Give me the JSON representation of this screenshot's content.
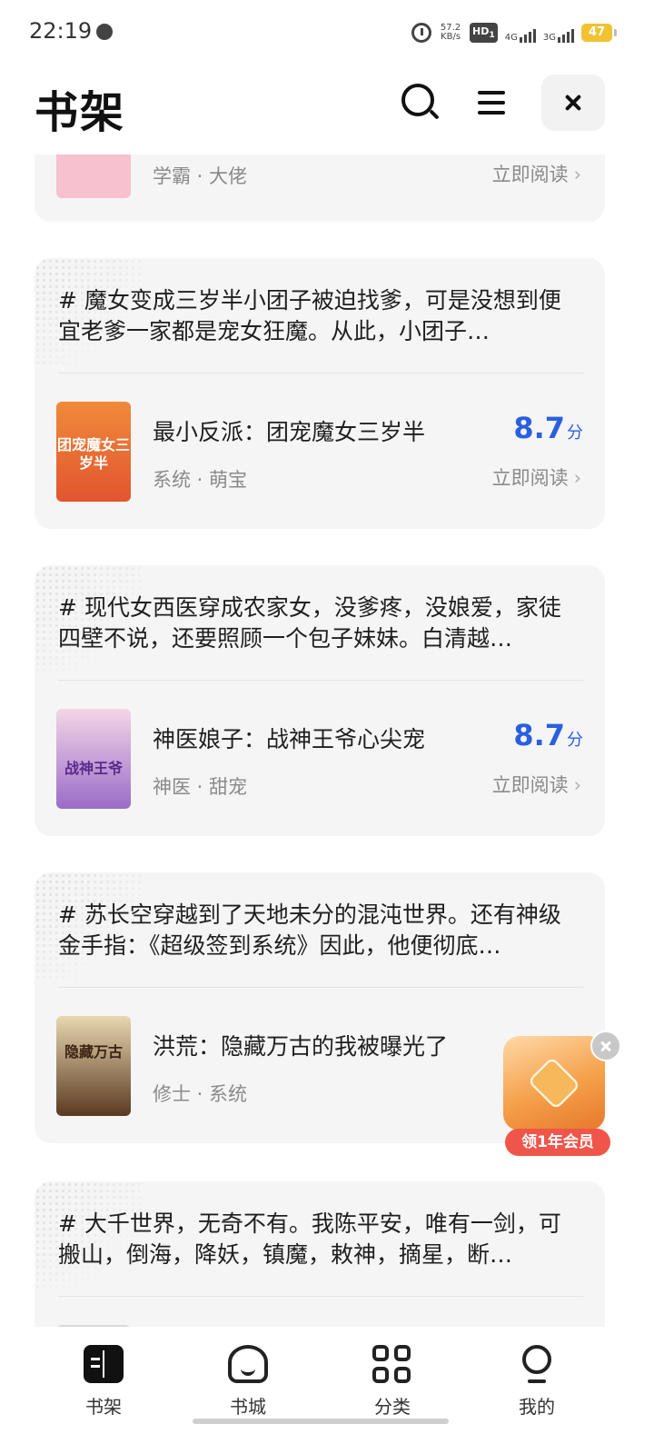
{
  "status_bar": {
    "time": "22:19",
    "net_speed_value": "57.2",
    "net_speed_unit": "KB/s",
    "hd_label": "HD",
    "hd_sub": "1",
    "net1": "4G",
    "net2": "3G",
    "battery": "47"
  },
  "header": {
    "title": "书架"
  },
  "cards": [
    {
      "blurb": "",
      "book_title": "",
      "tags": "学霸 · 大佬",
      "score": "",
      "score_unit": "",
      "read_label": "立即阅读",
      "cover_text": "",
      "cover_color": "#f7c1cf"
    },
    {
      "blurb": "# 魔女变成三岁半小团子被迫找爹，可是没想到便宜老爹一家都是宠女狂魔。从此，小团子…",
      "book_title": "最小反派：团宠魔女三岁半",
      "tags": "系统 · 萌宝",
      "score": "8.7",
      "score_unit": "分",
      "read_label": "立即阅读",
      "cover_text": "团宠魔女三岁半",
      "cover_color": "#e2552f"
    },
    {
      "blurb": "# 现代女西医穿成农家女，没爹疼，没娘爱，家徒四壁不说，还要照顾一个包子妹妹。白清越…",
      "book_title": "神医娘子：战神王爷心尖宠",
      "tags": "神医 · 甜宠",
      "score": "8.7",
      "score_unit": "分",
      "read_label": "立即阅读",
      "cover_text": "战神王爷",
      "cover_color": "#b58bd8"
    },
    {
      "blurb": "# 苏长空穿越到了天地未分的混沌世界。还有神级金手指：《超级签到系统》因此，他便彻底…",
      "book_title": "洪荒：隐藏万古的我被曝光了",
      "tags": "修士 · 系统",
      "score": "",
      "score_unit": "",
      "read_label": "立",
      "cover_text": "隐藏万古",
      "cover_color": "#5a3a22"
    },
    {
      "blurb": "# 大千世界，无奇不有。我陈平安，唯有一剑，可搬山，倒海，降妖，镇魔，敕神，摘星，断…",
      "book_title": "",
      "tags": "",
      "score": "",
      "score_unit": "",
      "read_label": "",
      "cover_text": "",
      "cover_color": "#d9d9d9"
    }
  ],
  "vip_badge": {
    "label": "领1年会员"
  },
  "bottom_nav": [
    {
      "label": "书架",
      "icon": "bookshelf-icon"
    },
    {
      "label": "书城",
      "icon": "bookstore-icon"
    },
    {
      "label": "分类",
      "icon": "category-icon"
    },
    {
      "label": "我的",
      "icon": "profile-icon"
    }
  ],
  "colors": {
    "accent_score": "#2a5fe0",
    "card_bg": "#f5f5f5",
    "vip_ribbon": "#f0554a"
  }
}
